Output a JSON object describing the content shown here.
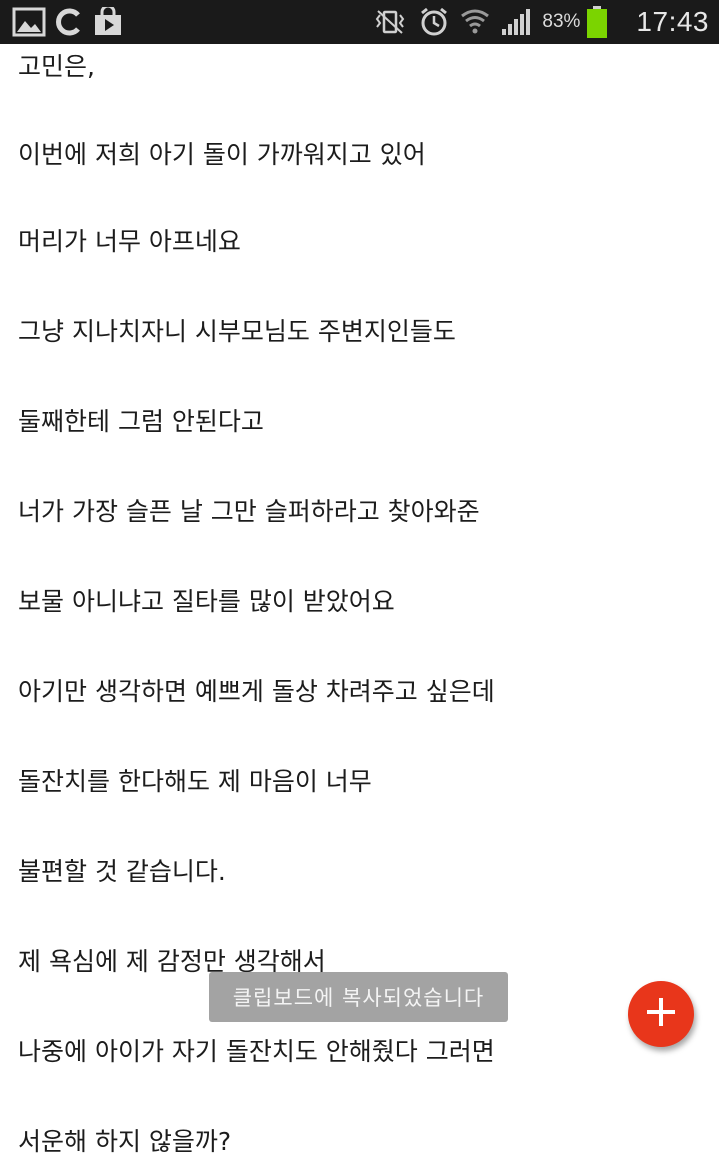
{
  "status_bar": {
    "left_icons": [
      "gallery-icon",
      "refresh-c-icon",
      "store-bag-icon"
    ],
    "right_icons": [
      "vibrate-icon",
      "alarm-icon",
      "wifi-icon",
      "signal-icon",
      "battery-icon"
    ],
    "battery_percent": "83%",
    "time": "17:43",
    "battery_color": "#7bd400"
  },
  "document": {
    "lines": [
      "고민은,",
      "이번에 저희 아기 돌이 가까워지고 있어",
      "머리가 너무 아프네요",
      "그냥 지나치자니 시부모님도 주변지인들도",
      "둘째한테 그럼 안된다고",
      "너가 가장 슬픈 날 그만 슬퍼하라고 찾아와준",
      "보물 아니냐고 질타를 많이 받았어요",
      "아기만 생각하면 예쁘게 돌상 차려주고 싶은데",
      "돌잔치를 한다해도 제 마음이 너무",
      "불편할 것 같습니다.",
      "제 욕심에 제 감정만 생각해서",
      "나중에 아이가 자기 돌잔치도 안해줬다 그러면",
      "서운해 하지 않을까?"
    ]
  },
  "toast": {
    "message": "클립보드에 복사되었습니다"
  },
  "fab": {
    "icon": "plus-icon",
    "color": "#e8361b"
  }
}
